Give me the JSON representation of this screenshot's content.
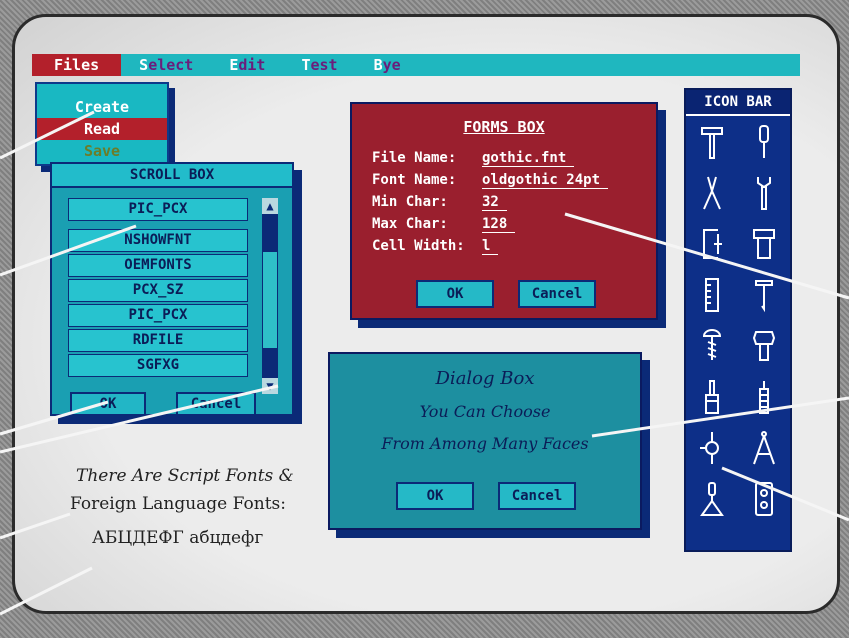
{
  "menubar": {
    "items": [
      {
        "label": "Files",
        "hot": "",
        "rest": "Files",
        "active": true
      },
      {
        "label": "Select",
        "hot": "S",
        "rest": "elect"
      },
      {
        "label": "Edit",
        "hot": "E",
        "rest": "dit"
      },
      {
        "label": "Test",
        "hot": "T",
        "rest": "est"
      },
      {
        "label": "Bye",
        "hot": "B",
        "rest": "ye"
      }
    ]
  },
  "files_menu": {
    "create": "Create",
    "read": "Read",
    "save": "Save"
  },
  "scroll_box": {
    "title": "SCROLL BOX",
    "selected": "PIC_PCX",
    "items": [
      "NSHOWFNT",
      "OEMFONTS",
      "PCX_SZ",
      "PIC_PCX",
      "RDFILE",
      "SGFXG"
    ],
    "ok_label": "OK",
    "cancel_label": "Cancel",
    "up_arrow": "▲",
    "down_arrow": "▼"
  },
  "forms_box": {
    "title": "FORMS BOX",
    "fields": [
      {
        "label": "File Name:",
        "value": "gothic.fnt"
      },
      {
        "label": "Font Name:",
        "value": "oldgothic 24pt"
      },
      {
        "label": "Min Char:",
        "value": "32"
      },
      {
        "label": "Max Char:",
        "value": "128"
      },
      {
        "label": "Cell Width:",
        "value": "l"
      }
    ],
    "ok_label": "OK",
    "cancel_label": "Cancel"
  },
  "dialog_box": {
    "title": "Dialog Box",
    "line1": "You Can Choose",
    "line2": "From Among Many Faces",
    "ok_label": "OK",
    "cancel_label": "Cancel"
  },
  "icon_bar": {
    "title": "ICON BAR",
    "icons": [
      "hammer-icon",
      "screwdriver-icon",
      "pliers-icon",
      "wrench-icon",
      "c-clamp-icon",
      "vise-icon",
      "ruler-icon",
      "nail-icon",
      "screw-icon",
      "bolt-icon",
      "paintbrush-icon",
      "file-rasp-icon",
      "hand-drill-icon",
      "compass-icon",
      "trowel-icon",
      "outlet-icon"
    ]
  },
  "script_text": {
    "line1": "There Are Script Fonts &",
    "line2": "Foreign Language Fonts:",
    "cyrillic": "АБЦДЕФГ абцдефг"
  },
  "colors": {
    "menu_teal": "#1fb7bf",
    "menu_active": "#b3202b",
    "forms_red": "#9a1f2e",
    "dialog_teal": "#1d8fa0",
    "iconbar_blue": "#0d2f88"
  }
}
